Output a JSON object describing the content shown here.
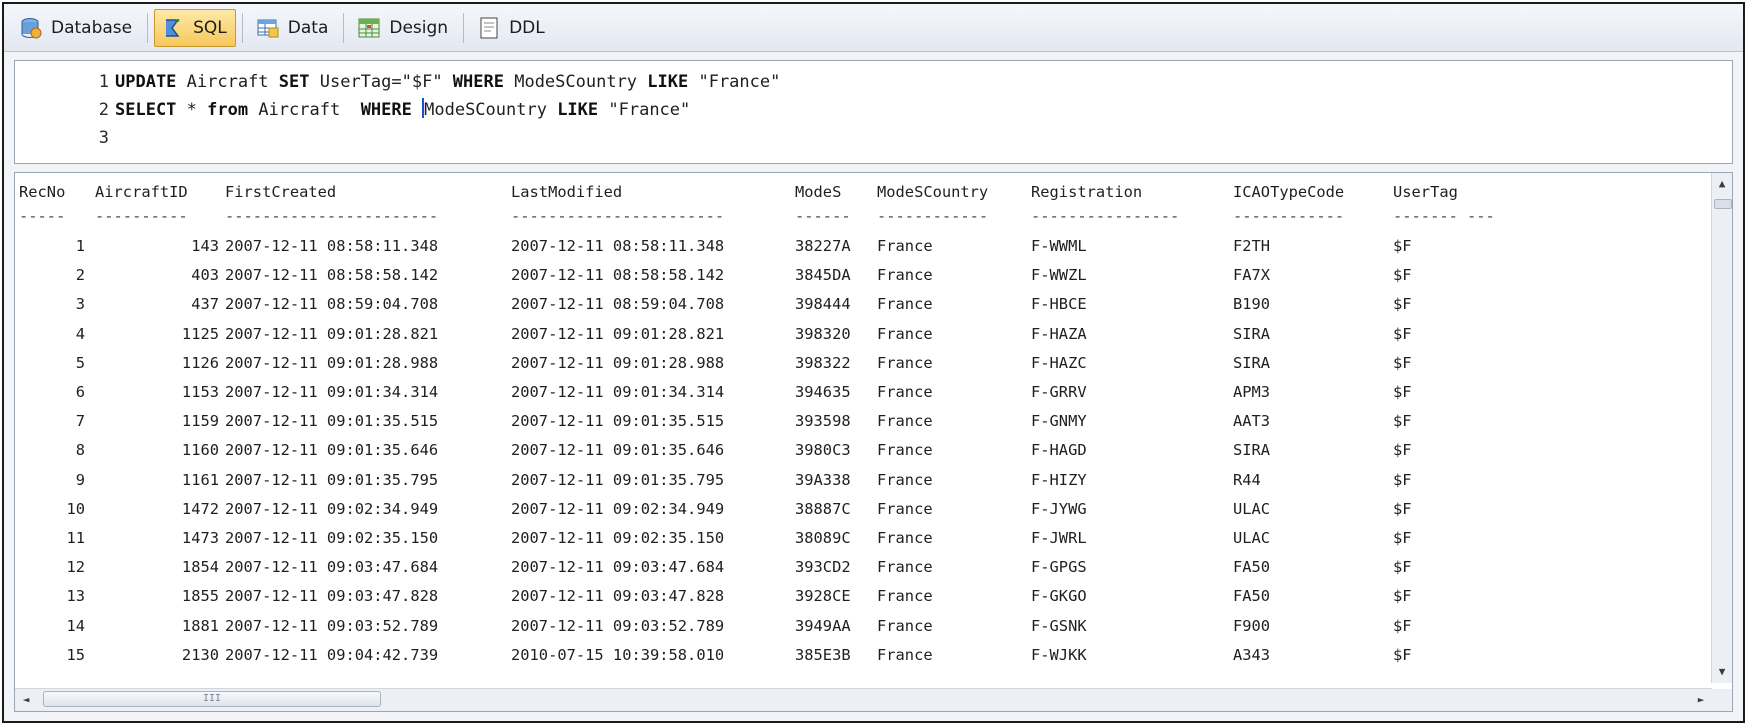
{
  "toolbar": {
    "tabs": [
      {
        "label": "Database",
        "icon": "database-icon"
      },
      {
        "label": "SQL",
        "icon": "sql-icon",
        "active": true
      },
      {
        "label": "Data",
        "icon": "data-grid-icon"
      },
      {
        "label": "Design",
        "icon": "design-table-icon"
      },
      {
        "label": "DDL",
        "icon": "ddl-document-icon"
      }
    ]
  },
  "editor": {
    "lines": [
      {
        "num": "1",
        "parts": [
          [
            "kw",
            "UPDATE"
          ],
          [
            "tx",
            " Aircraft "
          ],
          [
            "kw",
            "SET"
          ],
          [
            "tx",
            " UserTag=\"$F\" "
          ],
          [
            "kw",
            "WHERE"
          ],
          [
            "tx",
            " ModeSCountry "
          ],
          [
            "kw",
            "LIKE"
          ],
          [
            "tx",
            " \"France\""
          ]
        ]
      },
      {
        "num": "2",
        "parts": [
          [
            "kw",
            "SELECT"
          ],
          [
            "tx",
            " * "
          ],
          [
            "kw",
            "from"
          ],
          [
            "tx",
            " Aircraft  "
          ],
          [
            "kw",
            "WHERE"
          ],
          [
            "tx",
            " "
          ],
          [
            "caret",
            ""
          ],
          [
            "tx",
            "ModeSCountry "
          ],
          [
            "kw",
            "LIKE"
          ],
          [
            "tx",
            " \"France\""
          ]
        ]
      },
      {
        "num": "3",
        "parts": []
      }
    ]
  },
  "results": {
    "columns": [
      "RecNo",
      "AircraftID",
      "FirstCreated",
      "LastModified",
      "ModeS",
      "ModeSCountry",
      "Registration",
      "ICAOTypeCode",
      "UserTag"
    ],
    "dashes": [
      "-----",
      "----------",
      "-----------------------",
      "-----------------------",
      "------",
      "------------",
      "----------------",
      "------------",
      "-------",
      "---"
    ],
    "rows": [
      [
        "1",
        "143",
        "2007-12-11 08:58:11.348",
        "2007-12-11 08:58:11.348",
        "38227A",
        "France",
        "F-WWML",
        "F2TH",
        "$F"
      ],
      [
        "2",
        "403",
        "2007-12-11 08:58:58.142",
        "2007-12-11 08:58:58.142",
        "3845DA",
        "France",
        "F-WWZL",
        "FA7X",
        "$F"
      ],
      [
        "3",
        "437",
        "2007-12-11 08:59:04.708",
        "2007-12-11 08:59:04.708",
        "398444",
        "France",
        "F-HBCE",
        "B190",
        "$F"
      ],
      [
        "4",
        "1125",
        "2007-12-11 09:01:28.821",
        "2007-12-11 09:01:28.821",
        "398320",
        "France",
        "F-HAZA",
        "SIRA",
        "$F"
      ],
      [
        "5",
        "1126",
        "2007-12-11 09:01:28.988",
        "2007-12-11 09:01:28.988",
        "398322",
        "France",
        "F-HAZC",
        "SIRA",
        "$F"
      ],
      [
        "6",
        "1153",
        "2007-12-11 09:01:34.314",
        "2007-12-11 09:01:34.314",
        "394635",
        "France",
        "F-GRRV",
        "APM3",
        "$F"
      ],
      [
        "7",
        "1159",
        "2007-12-11 09:01:35.515",
        "2007-12-11 09:01:35.515",
        "393598",
        "France",
        "F-GNMY",
        "AAT3",
        "$F"
      ],
      [
        "8",
        "1160",
        "2007-12-11 09:01:35.646",
        "2007-12-11 09:01:35.646",
        "3980C3",
        "France",
        "F-HAGD",
        "SIRA",
        "$F"
      ],
      [
        "9",
        "1161",
        "2007-12-11 09:01:35.795",
        "2007-12-11 09:01:35.795",
        "39A338",
        "France",
        "F-HIZY",
        "R44",
        "$F"
      ],
      [
        "10",
        "1472",
        "2007-12-11 09:02:34.949",
        "2007-12-11 09:02:34.949",
        "38887C",
        "France",
        "F-JYWG",
        "ULAC",
        "$F"
      ],
      [
        "11",
        "1473",
        "2007-12-11 09:02:35.150",
        "2007-12-11 09:02:35.150",
        "38089C",
        "France",
        "F-JWRL",
        "ULAC",
        "$F"
      ],
      [
        "12",
        "1854",
        "2007-12-11 09:03:47.684",
        "2007-12-11 09:03:47.684",
        "393CD2",
        "France",
        "F-GPGS",
        "FA50",
        "$F"
      ],
      [
        "13",
        "1855",
        "2007-12-11 09:03:47.828",
        "2007-12-11 09:03:47.828",
        "3928CE",
        "France",
        "F-GKGO",
        "FA50",
        "$F"
      ],
      [
        "14",
        "1881",
        "2007-12-11 09:03:52.789",
        "2007-12-11 09:03:52.789",
        "3949AA",
        "France",
        "F-GSNK",
        "F900",
        "$F"
      ],
      [
        "15",
        "2130",
        "2007-12-11 09:04:42.739",
        "2010-07-15 10:39:58.010",
        "385E3B",
        "France",
        "F-WJKK",
        "A343",
        "$F"
      ]
    ]
  },
  "scrollbar": {
    "up_arrow": "▲",
    "down_arrow": "▼",
    "left_arrow": "◄",
    "right_arrow": "►",
    "grip": "III"
  }
}
